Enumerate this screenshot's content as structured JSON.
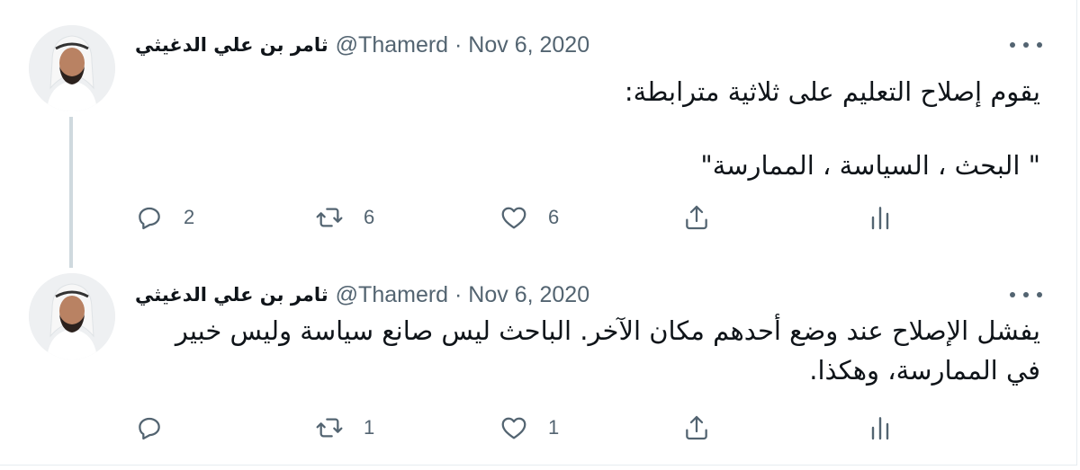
{
  "tweets": [
    {
      "author_name": "ثامر بن علي الدغيثي",
      "meta": "@Thamerd · Nov 6, 2020",
      "text_lines": [
        "يقوم إصلاح التعليم على ثلاثية مترابطة:",
        "\" البحث ، السياسة ، الممارسة\""
      ],
      "replies": "2",
      "retweets": "6",
      "likes": "6"
    },
    {
      "author_name": "ثامر بن علي الدغيثي",
      "meta": "@Thamerd · Nov 6, 2020",
      "text_lines": [
        "يفشل الإصلاح عند وضع أحدهم مكان الآخر. الباحث ليس صانع سياسة وليس خبير",
        "في الممارسة، وهكذا."
      ],
      "replies": "",
      "retweets": "1",
      "likes": "1"
    }
  ],
  "icons": {
    "reply": "reply-icon",
    "retweet": "retweet-icon",
    "like": "heart-icon",
    "share": "share-icon",
    "stats": "analytics-icon",
    "more": "more-icon"
  },
  "colors": {
    "text": "#0f1419",
    "secondary": "#536471",
    "thread": "#cfd9de"
  }
}
